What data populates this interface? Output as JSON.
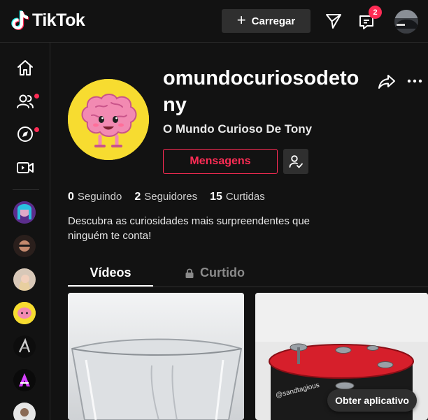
{
  "header": {
    "brand": "TikTok",
    "upload_label": "Carregar",
    "inbox_count": "2"
  },
  "sidebar": {
    "items": [
      {
        "name": "home-icon"
      },
      {
        "name": "friends-icon",
        "dot": true
      },
      {
        "name": "explore-icon",
        "dot": true
      },
      {
        "name": "live-icon"
      }
    ],
    "following_count_shown": 7
  },
  "profile": {
    "username": "omundocuriosodetony",
    "nickname": "O Mundo Curioso De Tony",
    "message_label": "Mensagens",
    "stats": [
      {
        "value": "0",
        "label": "Seguindo"
      },
      {
        "value": "2",
        "label": "Seguidores"
      },
      {
        "value": "15",
        "label": "Curtidas"
      }
    ],
    "bio": "Descubra as curiosidades mais surpreendentes que ninguém te conta!"
  },
  "tabs": {
    "videos": "Vídeos",
    "liked": "Curtido"
  },
  "videos": [
    {
      "name": "video-glass"
    },
    {
      "name": "video-red-sand",
      "watermark": "@sandtagious"
    }
  ],
  "get_app_label": "Obter aplicativo",
  "colors": {
    "background": "#121212",
    "accent": "#fe2c55",
    "surface": "#2f2f2f"
  }
}
